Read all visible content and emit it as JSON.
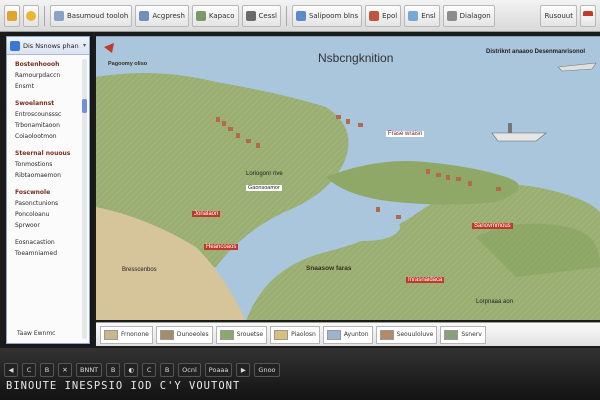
{
  "toolbar": {
    "buttons": [
      {
        "label": "",
        "icon": "folder-icon",
        "color": "#e0a52f"
      },
      {
        "label": "",
        "icon": "star-icon",
        "color": "#e8b930"
      },
      {
        "label": "Basumoud tooloh",
        "icon": "page-icon",
        "color": "#8aa2c8"
      },
      {
        "label": "Acgpresh",
        "icon": "grid-icon",
        "color": "#6f8fbf"
      },
      {
        "label": "Kapaco",
        "icon": "layers-icon",
        "color": "#7a9a6a"
      },
      {
        "label": "Cessl",
        "icon": "cursor-icon",
        "color": "#6a6a6a"
      },
      {
        "label": "Salipoom blns",
        "icon": "view-icon",
        "color": "#5f8ac9"
      },
      {
        "label": "Epol",
        "icon": "palette-icon",
        "color": "#c0573a"
      },
      {
        "label": "Ensl",
        "icon": "image-icon",
        "color": "#7aa6d6"
      },
      {
        "label": "Dialagon",
        "icon": "tool-icon",
        "color": "#8c8c8c"
      }
    ],
    "right_label": "Rusouut",
    "flag_icon": "flag-icon"
  },
  "sidebar": {
    "header_label": "Dis Nsnows phan",
    "dropdown": "▾",
    "items": [
      {
        "label": "Bostenhoooh",
        "head": true
      },
      {
        "label": "Ramourpdaccn",
        "head": false
      },
      {
        "label": "Ensmt",
        "head": false
      },
      {
        "gap": true
      },
      {
        "label": "Swoelannst",
        "head": true
      },
      {
        "label": "Entroscounsssc",
        "head": false
      },
      {
        "label": "Trbonamitaoon",
        "head": false
      },
      {
        "label": "Coiaolootmon",
        "head": false
      },
      {
        "gap": true
      },
      {
        "label": "Steernal nouous",
        "head": true
      },
      {
        "label": "Tonmostions",
        "head": false
      },
      {
        "label": "Ribtaomaemon",
        "head": false
      },
      {
        "gap": true
      },
      {
        "label": "Foscwnole",
        "head": true
      },
      {
        "label": "Pasonctunions",
        "head": false
      },
      {
        "label": "Poncoloanu",
        "head": false
      },
      {
        "label": "Sprwoor",
        "head": false
      },
      {
        "gap": true
      },
      {
        "label": "Eosnacastion",
        "head": false
      },
      {
        "label": "Toeamniamed",
        "head": false
      }
    ],
    "footer": "Taaw Ewnmc"
  },
  "map": {
    "title": "Nsbcngknition",
    "top_right_label": "Distriknt anaaoo Desenmanrisonol",
    "labels": {
      "ridge": "Pagoomy oliso",
      "bay": "Frase wraisn",
      "lake": "Loriogonr rive",
      "region": "Bresscenbos",
      "valley": "Snaasow faras",
      "south": "Inrasnaidaca",
      "coast": "Lorpnaaa aon",
      "town": "Gaonsoamor",
      "red_a": "Jonalaon",
      "red_b": "Heancoaos",
      "red_c": "Sanovmmous"
    },
    "colors": {
      "water": "#a9c6dc",
      "land": "#9eb276",
      "sand": "#d6c49a",
      "accent": "#c0392b"
    }
  },
  "strip": {
    "items": [
      {
        "label": "Frnonone",
        "color": "#c9b58e"
      },
      {
        "label": "Dunoeoles",
        "color": "#a48c6c"
      },
      {
        "label": "Srouetse",
        "color": "#8aa96a"
      },
      {
        "label": "Piaolosn",
        "color": "#d9c07a"
      },
      {
        "label": "Ayunton",
        "color": "#9bb4d0"
      },
      {
        "label": "Seouuloluve",
        "color": "#b7876a"
      },
      {
        "label": "Ssnerv",
        "color": "#88a07c"
      }
    ]
  },
  "bottom": {
    "buttons": [
      "◀",
      "C",
      "B",
      "✕",
      "BNNT",
      "B",
      "◐",
      "C",
      "B",
      "Ocnl",
      "Poaaa",
      "▶",
      "Gnoo"
    ],
    "title": "BINOUTE  INESPSIO  IOD C'Y  VOUTONT"
  }
}
